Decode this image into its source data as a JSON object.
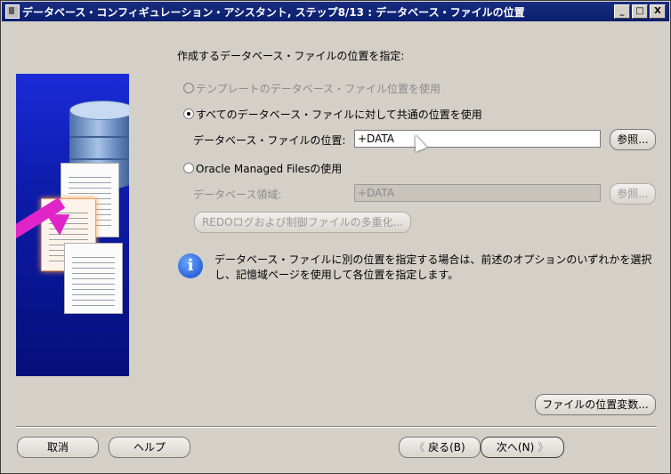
{
  "window": {
    "title": "データベース・コンフィギュレーション・アシスタント, ステップ8/13 : データベース・ファイルの位置",
    "min_label": "_",
    "max_label": "□",
    "close_label": "X"
  },
  "main": {
    "heading": "作成するデータベース・ファイルの位置を指定:",
    "options": [
      {
        "label": "テンプレートのデータベース・ファイル位置を使用",
        "checked": false,
        "enabled": false
      },
      {
        "label": "すべてのデータベース・ファイルに対して共通の位置を使用",
        "checked": true,
        "enabled": true
      },
      {
        "label": "Oracle Managed Filesの使用",
        "checked": false,
        "enabled": true
      }
    ],
    "common_location": {
      "label": "データベース・ファイルの位置:",
      "value": "+DATA",
      "browse_label": "参照..."
    },
    "omf": {
      "label": "データベース領域:",
      "value": "+DATA",
      "browse_label": "参照...",
      "multiplex_label": "REDOログおよび制御ファイルの多重化..."
    },
    "info_icon_glyph": "i",
    "info_text": "データベース・ファイルに別の位置を指定する場合は、前述のオプションのいずれかを選択し、記憶域ページを使用して各位置を指定します。",
    "file_location_vars_label": "ファイルの位置変数..."
  },
  "footer": {
    "cancel_label": "取消",
    "help_label": "ヘルプ",
    "back_label": "戻る(B)",
    "next_label": "次へ(N)",
    "back_glyph": "《",
    "next_glyph": "》"
  },
  "colors": {
    "title_bar": "#0a246a",
    "art_background": "#0d1ba8",
    "dialog_background": "#d4d0c8",
    "arrow": "#e024c8"
  }
}
